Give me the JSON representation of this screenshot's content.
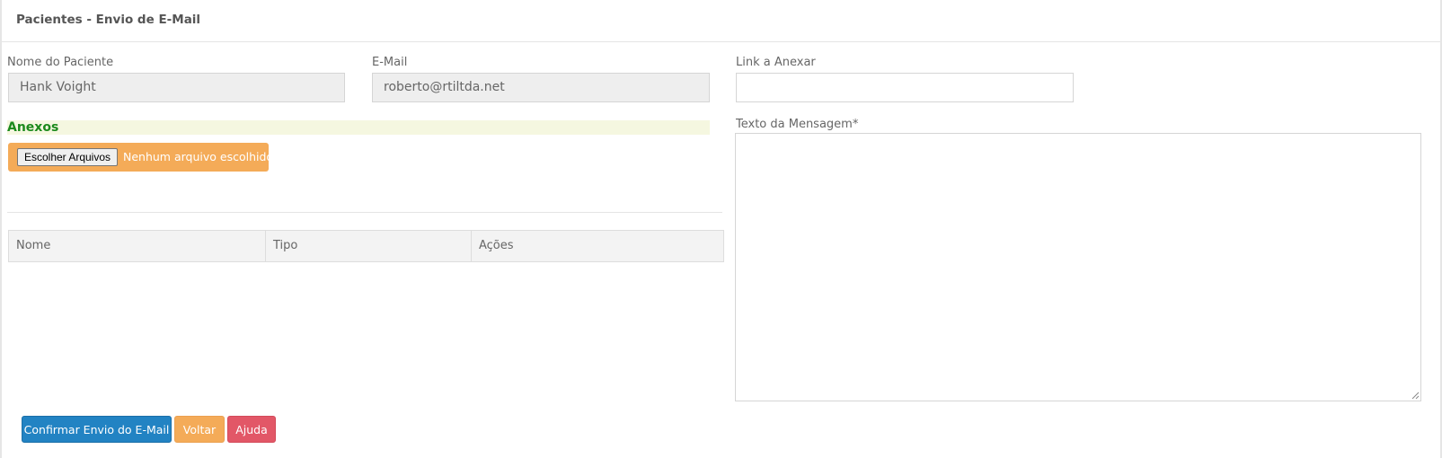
{
  "header": {
    "title": "Pacientes - Envio de E-Mail"
  },
  "form": {
    "patient_name": {
      "label": "Nome do Paciente",
      "value": "Hank Voight"
    },
    "email": {
      "label": "E-Mail",
      "value": "roberto@rtiltda.net"
    },
    "link": {
      "label": "Link a Anexar",
      "value": ""
    },
    "message": {
      "label": "Texto da Mensagem*",
      "value": ""
    }
  },
  "attachments": {
    "title": "Anexos",
    "choose_button": "Escolher Arquivos",
    "file_status": "Nenhum arquivo escolhido",
    "columns": [
      "Nome",
      "Tipo",
      "Ações"
    ],
    "rows": []
  },
  "actions": {
    "confirm": "Confirmar Envio do E-Mail",
    "back": "Voltar",
    "help": "Ajuda"
  },
  "colors": {
    "primary": "#2283c3",
    "warning": "#f4ab58",
    "danger": "#e25767",
    "section_title": "#1c8a1c"
  }
}
